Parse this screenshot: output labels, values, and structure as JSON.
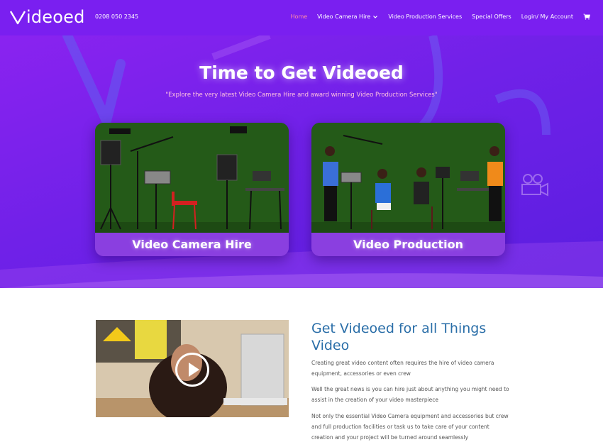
{
  "header": {
    "logo_text": "ideoed",
    "phone": "0208 050 2345",
    "nav": [
      {
        "label": "Home",
        "active": true
      },
      {
        "label": "Video Camera Hire",
        "has_dropdown": true
      },
      {
        "label": "Video Production Services"
      },
      {
        "label": "Special Offers"
      },
      {
        "label": "Login/ My Account"
      }
    ],
    "cart_icon": "cart-icon"
  },
  "hero": {
    "title": "Time to Get Videoed",
    "subtitle": "\"Explore the very latest Video Camera Hire and award winning Video Production Services\"",
    "cards": [
      {
        "label": "Video Camera Hire"
      },
      {
        "label": "Video Production"
      }
    ]
  },
  "intro": {
    "title": "Get Videoed for all Things Video",
    "paragraphs": [
      "Creating great video content often requires the hire of video camera equipment, accessories or even crew",
      "Well the great news is you can hire just about anything you might need to assist in the creation of your video masterpiece",
      "Not only the essential Video Camera equipment and accessories but crew and full production facilities or task us to take care of your content creation and your project will be turned around seamlessly"
    ]
  },
  "colors": {
    "header": "#7a1ff0",
    "hero_start": "#8a23f0",
    "hero_end": "#5a1ee0",
    "title_blue": "#2a6ea8",
    "nav_active": "#ff8aa8"
  }
}
